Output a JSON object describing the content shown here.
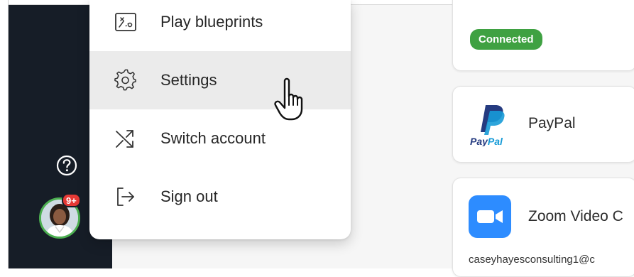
{
  "menu": {
    "items": [
      {
        "label": "Play blueprints",
        "icon": "blueprint-icon"
      },
      {
        "label": "Settings",
        "icon": "gear-icon"
      },
      {
        "label": "Switch account",
        "icon": "shuffle-icon"
      },
      {
        "label": "Sign out",
        "icon": "sign-out-icon"
      }
    ],
    "hovered_item": "Settings"
  },
  "sidebar": {
    "help_icon": "question-circle-icon",
    "avatar": {
      "notification_count": "9+"
    }
  },
  "integrations": {
    "top_card": {
      "status": "Connected"
    },
    "paypal": {
      "name": "PayPal",
      "logo_text": "PayPal"
    },
    "zoom": {
      "name": "Zoom Video C",
      "account_email": "caseyhayesconsulting1@c"
    }
  },
  "colors": {
    "sidebar_bg": "#161d27",
    "connected_green": "#3fa142",
    "badge_red": "#e53935",
    "zoom_blue": "#2d8cff",
    "paypal_dark": "#253b80",
    "paypal_light": "#179bd7"
  }
}
